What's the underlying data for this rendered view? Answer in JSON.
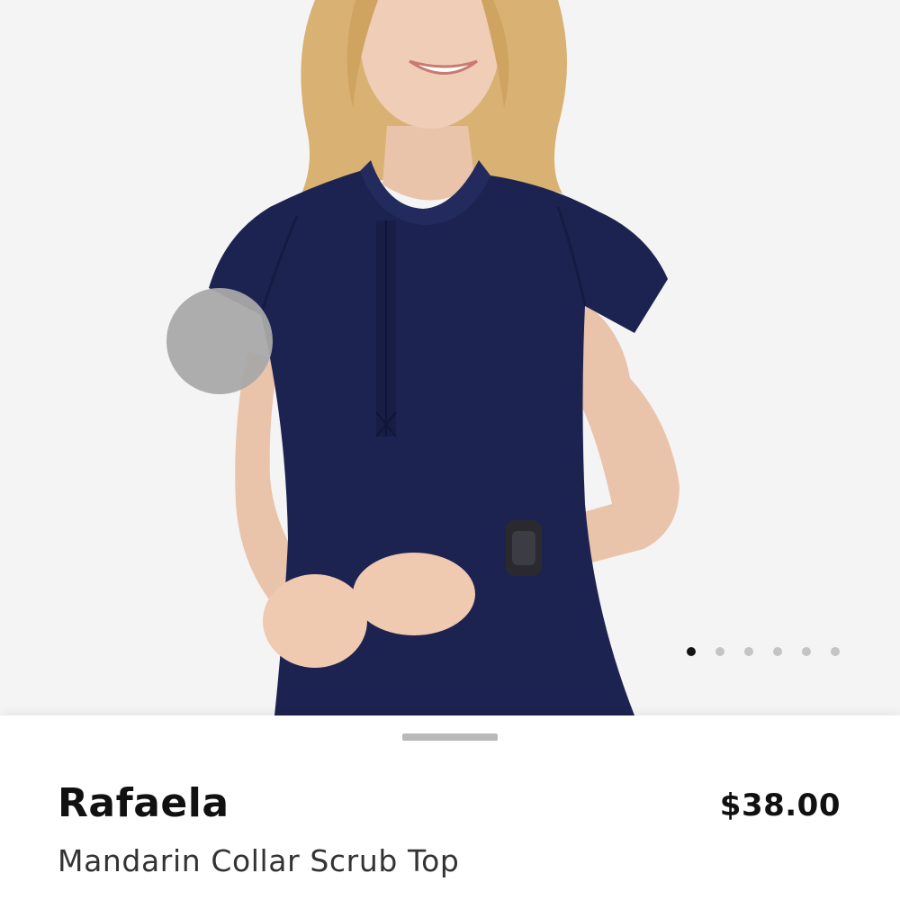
{
  "product": {
    "name": "Rafaela",
    "subtitle": "Mandarin Collar Scrub Top",
    "price": "$38.00"
  },
  "gallery": {
    "image_count": 6,
    "active_index": 0,
    "photo_description_icon": "model-wearing-navy-scrub-top-photo"
  },
  "colors": {
    "gallery_background": "#f4f4f4",
    "garment_navy": "#1c2350",
    "pager_active": "#141414",
    "pager_inactive": "#c4c4c4",
    "text_primary": "#111111",
    "text_secondary": "#333333"
  }
}
